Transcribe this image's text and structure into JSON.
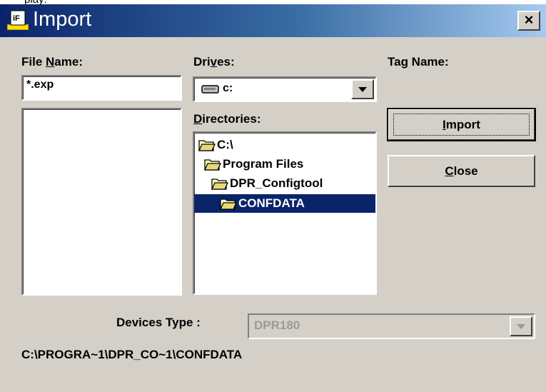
{
  "window": {
    "cut_off_text": "play:",
    "title": "Import",
    "close_glyph": "×"
  },
  "file_name": {
    "label_prefix": "File ",
    "label_mnemonic": "N",
    "label_suffix": "ame:",
    "value": "*.exp",
    "files": []
  },
  "drives": {
    "label_prefix": "Dri",
    "label_mnemonic": "v",
    "label_suffix": "es:",
    "selected": "c:",
    "icon": "drive-icon"
  },
  "directories": {
    "label_mnemonic": "D",
    "label_suffix": "irectories:",
    "items": [
      {
        "label": "C:\\",
        "icon": "open-folder-icon",
        "selected": false
      },
      {
        "label": "Program Files",
        "icon": "open-folder-icon",
        "selected": false
      },
      {
        "label": "DPR_Configtool",
        "icon": "open-folder-icon",
        "selected": false
      },
      {
        "label": "CONFDATA",
        "icon": "open-folder-icon",
        "selected": true
      }
    ]
  },
  "tag_name": {
    "label": "Tag Name:"
  },
  "buttons": {
    "import": {
      "mnemonic": "I",
      "rest": "mport"
    },
    "close": {
      "mnemonic": "C",
      "rest": "lose"
    }
  },
  "devices_type": {
    "label": "Devices Type :",
    "selected": "DPR180",
    "enabled": false
  },
  "current_path": "C:\\PROGRA~1\\DPR_CO~1\\CONFDATA",
  "colors": {
    "dialog_face": "#d4d0c8",
    "title_start": "#0a246a",
    "title_end": "#a6caf0",
    "selection": "#0a246a",
    "disabled_text": "#9a9a9a"
  }
}
